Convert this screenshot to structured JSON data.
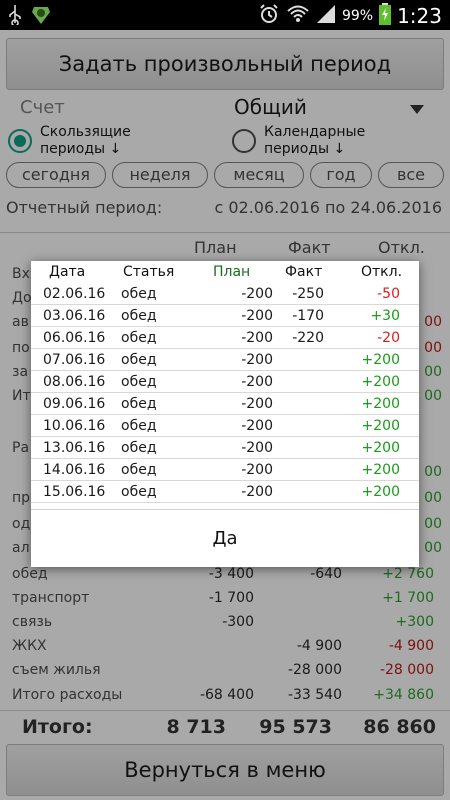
{
  "status_bar": {
    "battery": "99%",
    "time": "1:23"
  },
  "top_button": "Задать произвольный период",
  "account": {
    "label": "Счет",
    "value": "Общий"
  },
  "period_mode": {
    "sliding": "Скользящие\nпериоды ↓",
    "calendar": "Календарные\nпериоды ↓"
  },
  "pills": [
    "сегодня",
    "неделя",
    "месяц",
    "год",
    "все"
  ],
  "report_period": {
    "label": "Отчетный период:",
    "value": "с 02.06.2016 по 24.06.2016"
  },
  "bg_headers": {
    "plan": "План",
    "fact": "Факт",
    "dev": "Откл."
  },
  "bg_left_stubs": [
    "Вх",
    "До",
    "ав",
    "по",
    "за",
    "Ит",
    "Ра",
    "пр",
    "од",
    "ал"
  ],
  "bg_rows": [
    {
      "name": "обед",
      "plan": "-3 400",
      "fact": "-640",
      "dev": "+2 760",
      "sign": "pos"
    },
    {
      "name": "транспорт",
      "plan": "-1 700",
      "fact": "",
      "dev": "+1 700",
      "sign": "pos"
    },
    {
      "name": "связь",
      "plan": "-300",
      "fact": "",
      "dev": "+300",
      "sign": "pos"
    },
    {
      "name": "ЖКХ",
      "plan": "",
      "fact": "-4 900",
      "dev": "-4 900",
      "sign": "neg"
    },
    {
      "name": "съем жилья",
      "plan": "",
      "fact": "-28 000",
      "dev": "-28 000",
      "sign": "neg"
    },
    {
      "name": "Итого расходы",
      "plan": "-68 400",
      "fact": "-33 540",
      "dev": "+34 860",
      "sign": "pos"
    }
  ],
  "totals": {
    "label": "Итого:",
    "plan": "8 713",
    "fact": "95 573",
    "dev": "86 860"
  },
  "bottom_button": "Вернуться в меню",
  "dialog": {
    "headers": {
      "date": "Дата",
      "item": "Статья",
      "plan": "План",
      "fact": "Факт",
      "dev": "Откл."
    },
    "rows": [
      {
        "date": "02.06.16",
        "item": "обед",
        "plan": "-200",
        "fact": "-250",
        "dev": "-50",
        "sign": "neg"
      },
      {
        "date": "03.06.16",
        "item": "обед",
        "plan": "-200",
        "fact": "-170",
        "dev": "+30",
        "sign": "pos"
      },
      {
        "date": "06.06.16",
        "item": "обед",
        "plan": "-200",
        "fact": "-220",
        "dev": "-20",
        "sign": "neg"
      },
      {
        "date": "07.06.16",
        "item": "обед",
        "plan": "-200",
        "fact": "",
        "dev": "+200",
        "sign": "pos"
      },
      {
        "date": "08.06.16",
        "item": "обед",
        "plan": "-200",
        "fact": "",
        "dev": "+200",
        "sign": "pos"
      },
      {
        "date": "09.06.16",
        "item": "обед",
        "plan": "-200",
        "fact": "",
        "dev": "+200",
        "sign": "pos"
      },
      {
        "date": "10.06.16",
        "item": "обед",
        "plan": "-200",
        "fact": "",
        "dev": "+200",
        "sign": "pos"
      },
      {
        "date": "13.06.16",
        "item": "обед",
        "plan": "-200",
        "fact": "",
        "dev": "+200",
        "sign": "pos"
      },
      {
        "date": "14.06.16",
        "item": "обед",
        "plan": "-200",
        "fact": "",
        "dev": "+200",
        "sign": "pos"
      },
      {
        "date": "15.06.16",
        "item": "обед",
        "plan": "-200",
        "fact": "",
        "dev": "+200",
        "sign": "pos"
      }
    ],
    "ok_button": "Да"
  },
  "colors": {
    "negative": "#e01b1b",
    "positive": "#1a9a1a",
    "radio_accent": "#0a6a5a"
  }
}
